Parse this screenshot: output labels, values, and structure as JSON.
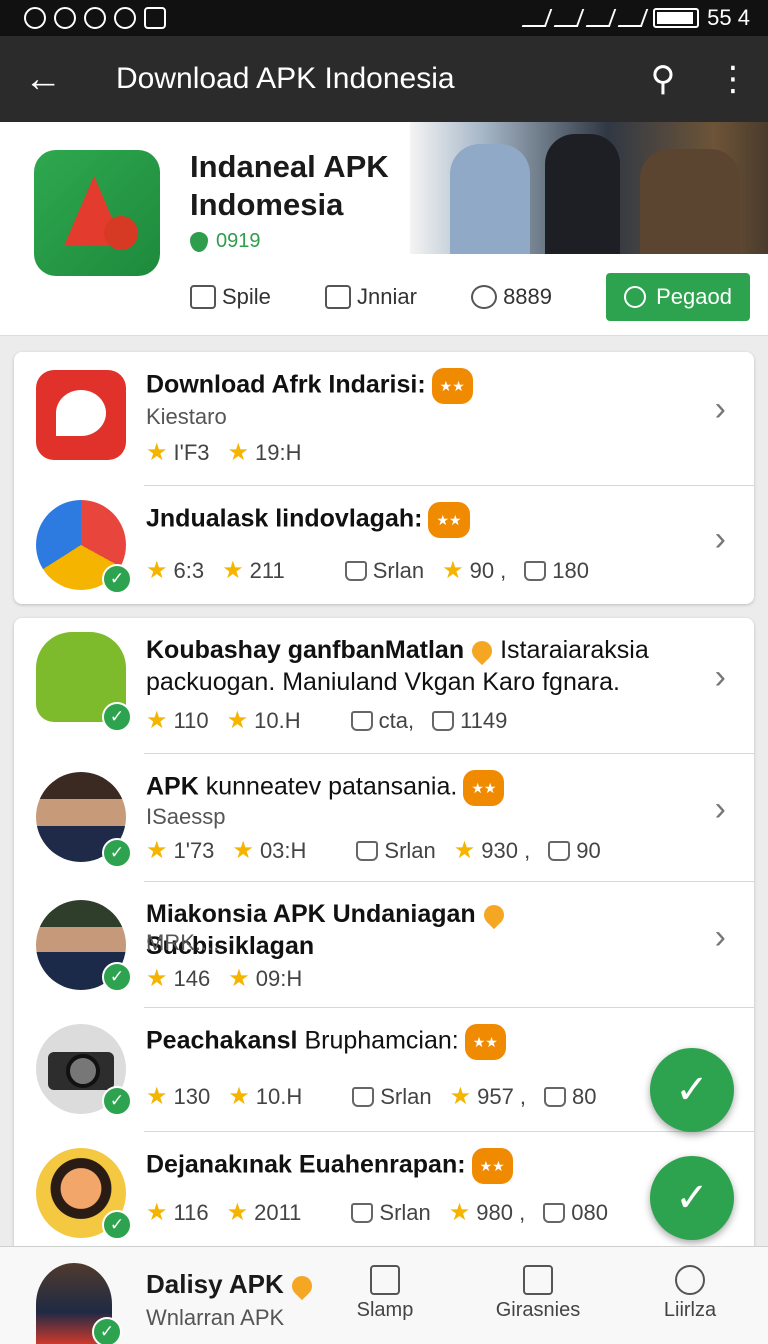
{
  "status": {
    "time": "55 4"
  },
  "appbar": {
    "title": "Download APK Indonesia"
  },
  "hero": {
    "title": "Indaneal APK Indomesia",
    "count": "0919",
    "actions": [
      {
        "label": "Spile"
      },
      {
        "label": "Jnniar"
      },
      {
        "label": "8889"
      }
    ],
    "primary_label": "Pegaod"
  },
  "list1": [
    {
      "title": "Download Afrk Indarisi:",
      "subtitle": "Kiestaro",
      "s1": "I'F3",
      "s2": "19:H",
      "extra": []
    },
    {
      "title": "Jndualask lindovlagah:",
      "subtitle": "",
      "s1": "6:3",
      "s2": "211",
      "extra": [
        "Srlan",
        "90 ,",
        "180"
      ]
    }
  ],
  "list2": [
    {
      "title": "Koubashay ganfbanMatlan",
      "title_tail": "Istaraiaraksia packuogan. Maniuland Vkgan Karo fgnara.",
      "s1": "110",
      "s2": "10.H",
      "extra": [
        "cta,",
        "1149"
      ]
    },
    {
      "title": "APK",
      "title_tail": "kunneatev patansania.",
      "subtitle": "ISaessp",
      "s1": "1'73",
      "s2": "03:H",
      "extra": [
        "Srlan",
        "930 ,",
        "90"
      ]
    },
    {
      "title": "Miakonsia APK Undaniagan",
      "title_tail": "Sucbisiklagan",
      "subtitle": "MRK....",
      "s1": "146",
      "s2": "09:H",
      "extra": []
    },
    {
      "title": "Peachakansl",
      "title_tail": "Bruphamcian:",
      "s1": "130",
      "s2": "10.H",
      "extra": [
        "Srlan",
        "957 ,",
        "80"
      ]
    },
    {
      "title": "Dejanakınak Euahenrapan:",
      "s1": "116",
      "s2": "2011",
      "extra": [
        "Srlan",
        "980 ,",
        "080"
      ]
    }
  ],
  "bottom": {
    "title": "Dalisy APK",
    "subtitle": "Wnlarran APK",
    "tabs": [
      {
        "label": "Slamp"
      },
      {
        "label": "Girasnies"
      },
      {
        "label": "Liirlza"
      }
    ]
  },
  "colors": {
    "accent": "#2ea34f",
    "appbar": "#2b2b2b",
    "star": "#f5b400"
  }
}
